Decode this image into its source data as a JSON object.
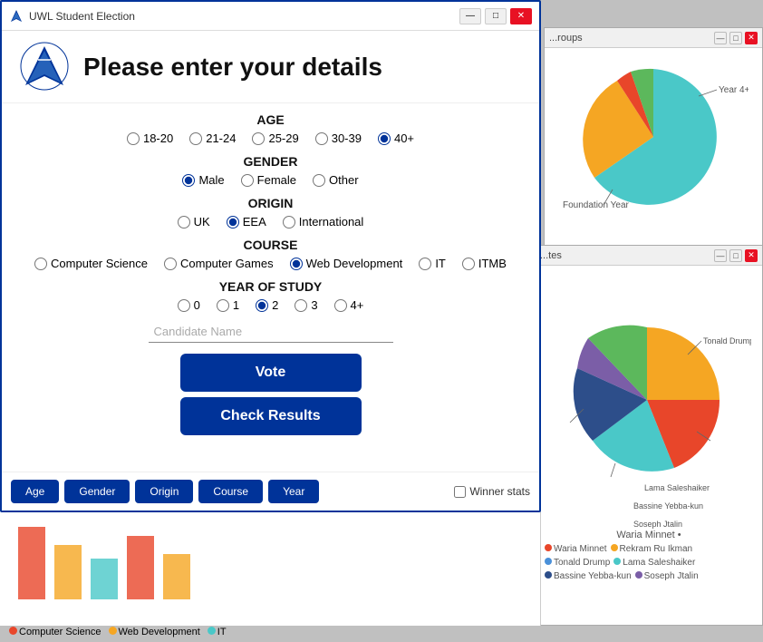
{
  "app": {
    "title": "UWL Student Election",
    "header_title": "Please enter your details"
  },
  "titlebar": {
    "minimize": "—",
    "maximize": "□",
    "close": "✕"
  },
  "form": {
    "age_label": "AGE",
    "age_options": [
      "18-20",
      "21-24",
      "25-29",
      "30-39",
      "40+"
    ],
    "age_selected": "40+",
    "gender_label": "GENDER",
    "gender_options": [
      "Male",
      "Female",
      "Other"
    ],
    "gender_selected": "Male",
    "origin_label": "ORIGIN",
    "origin_options": [
      "UK",
      "EEA",
      "International"
    ],
    "origin_selected": "EEA",
    "course_label": "COURSE",
    "course_options": [
      "Computer Science",
      "Computer Games",
      "Web Development",
      "IT",
      "ITMB"
    ],
    "course_selected": "Web Development",
    "year_label": "YEAR OF STUDY",
    "year_options": [
      "0",
      "1",
      "2",
      "3",
      "4+"
    ],
    "year_selected": "2",
    "candidate_placeholder": "Candidate Name",
    "vote_btn": "Vote",
    "check_btn": "Check Results"
  },
  "tabs": {
    "items": [
      "Age",
      "Gender",
      "Origin",
      "Course",
      "Year"
    ],
    "winner_stats_label": "Winner stats"
  },
  "bg_window1": {
    "title": "roups",
    "year4_label": "Year 4+",
    "foundation_label": "Foundation Year"
  },
  "bg_window2": {
    "title": "tes",
    "candidates": [
      "Tonald Drump",
      "Lama Saleshaiker",
      "Bassine Yebba-kun",
      "Soseph Jtalin"
    ]
  },
  "bottom_legend": {
    "items": [
      {
        "label": "Waria Minnet",
        "color": "#e8462a"
      },
      {
        "label": "Rekram Ru Ikman",
        "color": "#f5a623"
      },
      {
        "label": "Tonald Drump",
        "color": "#4a90d9"
      },
      {
        "label": "Lama Saleshaiker",
        "color": "#4ac8c8"
      },
      {
        "label": "Bassine Yebba-kun",
        "color": "#2d4e8a"
      },
      {
        "label": "Soseph Jtalin",
        "color": "#7b5ea7"
      }
    ]
  },
  "bottom_chart_legend": {
    "items": [
      {
        "label": "Computer Science",
        "color": "#e8462a"
      },
      {
        "label": "Web Development",
        "color": "#f5a623"
      },
      {
        "label": "IT",
        "color": "#4ac8c8"
      }
    ]
  }
}
